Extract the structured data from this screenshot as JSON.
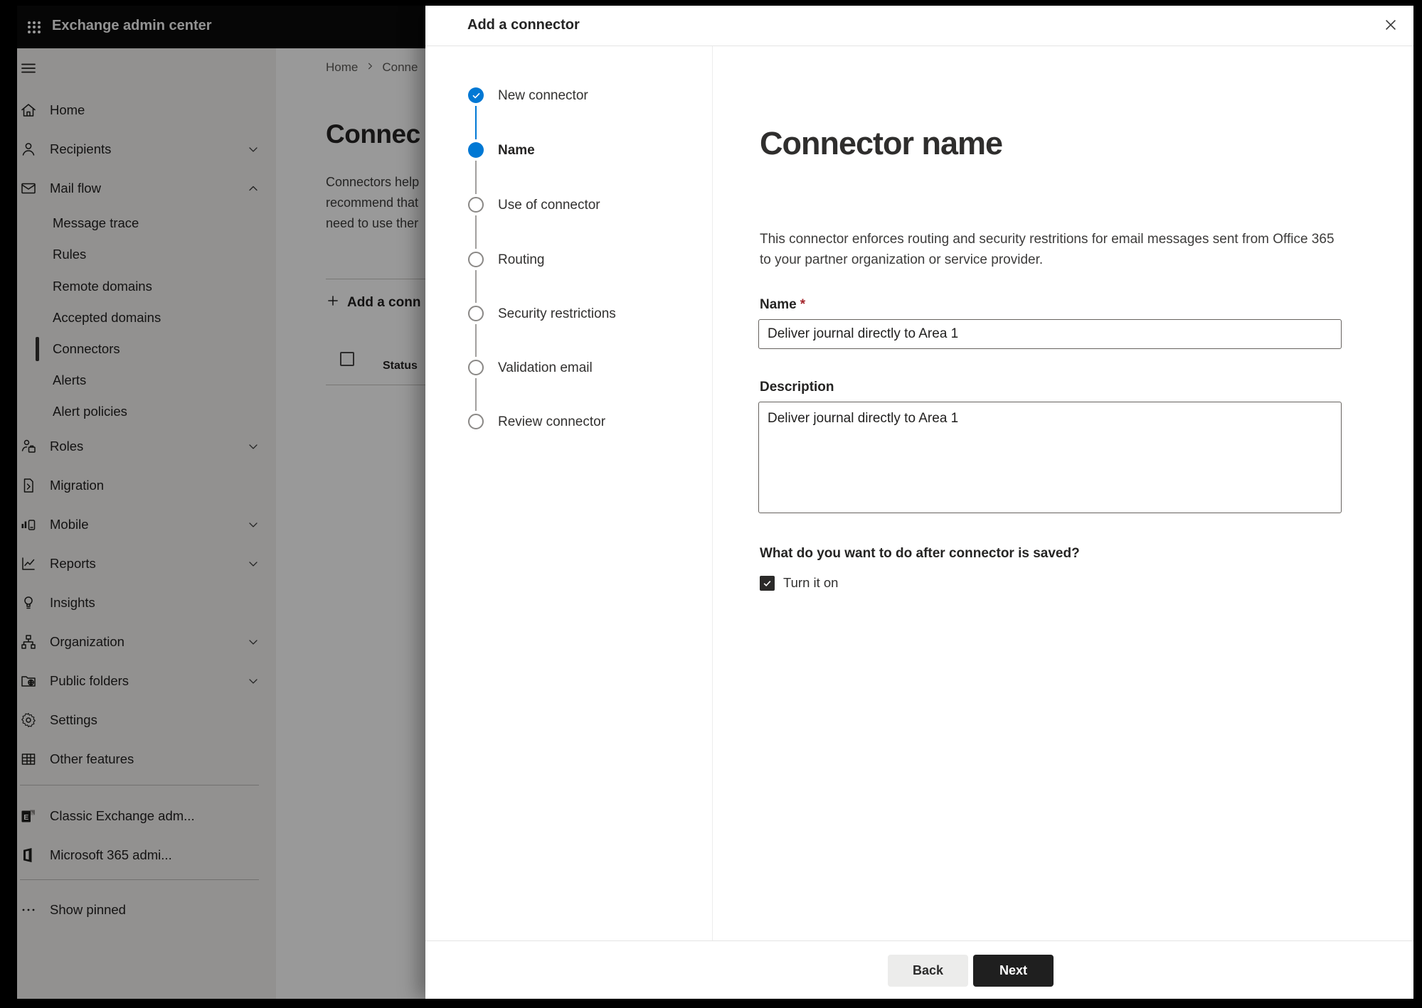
{
  "topbar": {
    "title": "Exchange admin center"
  },
  "sidebar": {
    "items": [
      {
        "label": "",
        "icon": "hamburger",
        "kind": "burger"
      },
      {
        "label": "Home",
        "icon": "home"
      },
      {
        "label": "Recipients",
        "icon": "person",
        "chevron": "down"
      },
      {
        "label": "Mail flow",
        "icon": "mail",
        "chevron": "up"
      },
      {
        "label": "Message trace",
        "sub": true
      },
      {
        "label": "Rules",
        "sub": true
      },
      {
        "label": "Remote domains",
        "sub": true
      },
      {
        "label": "Accepted domains",
        "sub": true
      },
      {
        "label": "Connectors",
        "sub": true,
        "selected": true
      },
      {
        "label": "Alerts",
        "sub": true
      },
      {
        "label": "Alert policies",
        "sub": true
      },
      {
        "label": "Roles",
        "icon": "roles",
        "chevron": "down"
      },
      {
        "label": "Migration",
        "icon": "migration"
      },
      {
        "label": "Mobile",
        "icon": "mobile",
        "chevron": "down"
      },
      {
        "label": "Reports",
        "icon": "reports",
        "chevron": "down"
      },
      {
        "label": "Insights",
        "icon": "insights"
      },
      {
        "label": "Organization",
        "icon": "organization",
        "chevron": "down"
      },
      {
        "label": "Public folders",
        "icon": "folder",
        "chevron": "down"
      },
      {
        "label": "Settings",
        "icon": "settings"
      },
      {
        "label": "Other features",
        "icon": "grid"
      },
      {
        "divider": true
      },
      {
        "label": "Classic Exchange adm...",
        "icon": "exchange"
      },
      {
        "label": "Microsoft 365 admi...",
        "icon": "office"
      },
      {
        "divider": true
      },
      {
        "label": "Show pinned",
        "icon": "dots"
      }
    ]
  },
  "background_page": {
    "breadcrumb_home": "Home",
    "breadcrumb_current": "Conne",
    "page_title": "Connec",
    "paragraph_lines": [
      "Connectors help",
      "recommend that",
      "need to use ther"
    ],
    "add_button_label": "Add a conn",
    "status_header": "Status"
  },
  "dialog": {
    "title": "Add a connector",
    "steps": [
      {
        "label": "New connector",
        "state": "complete"
      },
      {
        "label": "Name",
        "state": "current"
      },
      {
        "label": "Use of connector",
        "state": "upcoming"
      },
      {
        "label": "Routing",
        "state": "upcoming"
      },
      {
        "label": "Security restrictions",
        "state": "upcoming"
      },
      {
        "label": "Validation email",
        "state": "upcoming"
      },
      {
        "label": "Review connector",
        "state": "upcoming"
      }
    ],
    "heading": "Connector name",
    "description_lines": [
      "This connector enforces routing and security restritions for email messages sent from Office 365",
      "to your partner organization or service provider."
    ],
    "name_label": "Name",
    "required_mark": "*",
    "name_value": "Deliver journal directly to Area 1",
    "description_label": "Description",
    "description_value": "Deliver journal directly to Area 1",
    "after_save_question": "What do you want to do after connector is saved?",
    "turn_on_label": "Turn it on",
    "turn_on_checked": true,
    "back_label": "Back",
    "next_label": "Next"
  },
  "colors": {
    "accent_blue": "#0078d4",
    "topbar_bg": "#0a0a0a",
    "sidebar_bg": "#f3f2f1",
    "required_red": "#a4262c",
    "next_button_bg": "#1f1f1f",
    "back_button_bg": "#ececeb"
  }
}
